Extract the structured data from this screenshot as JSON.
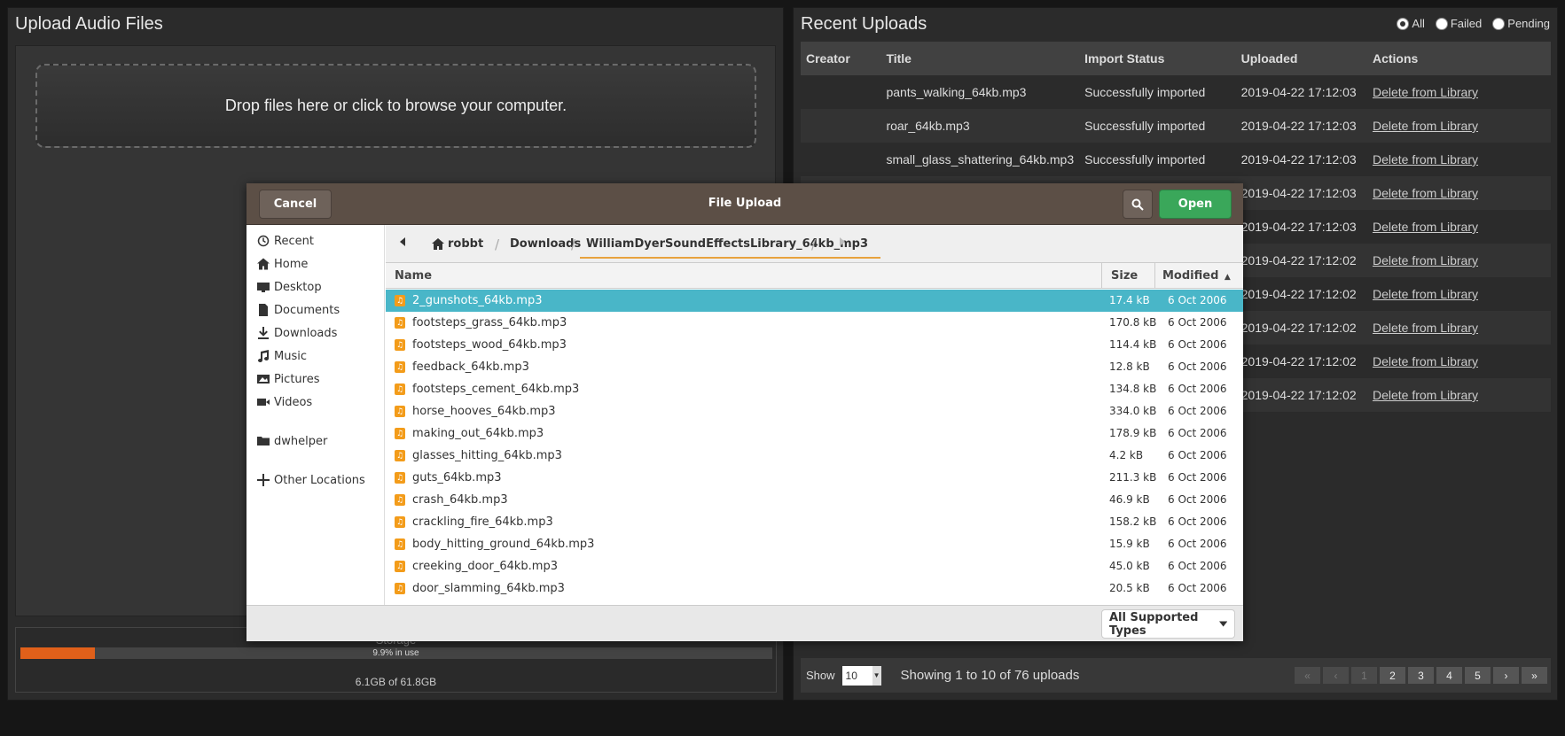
{
  "upload_panel": {
    "title": "Upload Audio Files",
    "dropzone_text": "Drop files here or click to browse your computer.",
    "storage": {
      "label": "Storage",
      "percent_text": "9.9% in use",
      "percent": 9.9,
      "total_text": "6.1GB of 61.8GB"
    }
  },
  "recent": {
    "title": "Recent Uploads",
    "filters": [
      {
        "label": "All",
        "checked": true
      },
      {
        "label": "Failed",
        "checked": false
      },
      {
        "label": "Pending",
        "checked": false
      }
    ],
    "columns": [
      "Creator",
      "Title",
      "Import Status",
      "Uploaded",
      "Actions"
    ],
    "rows": [
      {
        "creator": "",
        "title": "pants_walking_64kb.mp3",
        "status": "Successfully imported",
        "uploaded": "2019-04-22 17:12:03",
        "action": "Delete from Library"
      },
      {
        "creator": "",
        "title": "roar_64kb.mp3",
        "status": "Successfully imported",
        "uploaded": "2019-04-22 17:12:03",
        "action": "Delete from Library"
      },
      {
        "creator": "",
        "title": "small_glass_shattering_64kb.mp3",
        "status": "Successfully imported",
        "uploaded": "2019-04-22 17:12:03",
        "action": "Delete from Library"
      },
      {
        "creator": "",
        "title": "",
        "status": "",
        "uploaded": "2019-04-22 17:12:03",
        "action": "Delete from Library"
      },
      {
        "creator": "",
        "title": "",
        "status": "",
        "uploaded": "2019-04-22 17:12:03",
        "action": "Delete from Library"
      },
      {
        "creator": "",
        "title": "",
        "status": "",
        "uploaded": "2019-04-22 17:12:02",
        "action": "Delete from Library"
      },
      {
        "creator": "",
        "title": "",
        "status": "",
        "uploaded": "2019-04-22 17:12:02",
        "action": "Delete from Library"
      },
      {
        "creator": "",
        "title": "",
        "status": "",
        "uploaded": "2019-04-22 17:12:02",
        "action": "Delete from Library"
      },
      {
        "creator": "",
        "title": "",
        "status": "",
        "uploaded": "2019-04-22 17:12:02",
        "action": "Delete from Library"
      },
      {
        "creator": "",
        "title": "",
        "status": "",
        "uploaded": "2019-04-22 17:12:02",
        "action": "Delete from Library"
      }
    ],
    "footer": {
      "show_label": "Show",
      "show_value": "10",
      "showing_text": "Showing 1 to 10 of 76 uploads",
      "pages": [
        "«",
        "‹",
        "1",
        "2",
        "3",
        "4",
        "5",
        "›",
        "»"
      ]
    }
  },
  "dialog": {
    "title": "File Upload",
    "cancel_label": "Cancel",
    "open_label": "Open",
    "places": [
      "Recent",
      "Home",
      "Desktop",
      "Documents",
      "Downloads",
      "Music",
      "Pictures",
      "Videos",
      "dwhelper",
      "Other Locations"
    ],
    "breadcrumbs": [
      "robbt",
      "Downloads",
      "WilliamDyerSoundEffectsLibrary_64kb_mp3"
    ],
    "columns": {
      "name": "Name",
      "size": "Size",
      "modified": "Modified"
    },
    "files": [
      {
        "name": "2_gunshots_64kb.mp3",
        "size": "17.4 kB",
        "modified": "6 Oct 2006",
        "selected": true
      },
      {
        "name": "footsteps_grass_64kb.mp3",
        "size": "170.8 kB",
        "modified": "6 Oct 2006"
      },
      {
        "name": "footsteps_wood_64kb.mp3",
        "size": "114.4 kB",
        "modified": "6 Oct 2006"
      },
      {
        "name": "feedback_64kb.mp3",
        "size": "12.8 kB",
        "modified": "6 Oct 2006"
      },
      {
        "name": "footsteps_cement_64kb.mp3",
        "size": "134.8 kB",
        "modified": "6 Oct 2006"
      },
      {
        "name": "horse_hooves_64kb.mp3",
        "size": "334.0 kB",
        "modified": "6 Oct 2006"
      },
      {
        "name": "making_out_64kb.mp3",
        "size": "178.9 kB",
        "modified": "6 Oct 2006"
      },
      {
        "name": "glasses_hitting_64kb.mp3",
        "size": "4.2 kB",
        "modified": "6 Oct 2006"
      },
      {
        "name": "guts_64kb.mp3",
        "size": "211.3 kB",
        "modified": "6 Oct 2006"
      },
      {
        "name": "crash_64kb.mp3",
        "size": "46.9 kB",
        "modified": "6 Oct 2006"
      },
      {
        "name": "crackling_fire_64kb.mp3",
        "size": "158.2 kB",
        "modified": "6 Oct 2006"
      },
      {
        "name": "body_hitting_ground_64kb.mp3",
        "size": "15.9 kB",
        "modified": "6 Oct 2006"
      },
      {
        "name": "creeking_door_64kb.mp3",
        "size": "45.0 kB",
        "modified": "6 Oct 2006"
      },
      {
        "name": "door_slamming_64kb.mp3",
        "size": "20.5 kB",
        "modified": "6 Oct 2006"
      }
    ],
    "filter_label": "All Supported Types"
  },
  "colors": {
    "accent_orange": "#e0601a",
    "selection": "#49b6c8",
    "open_green": "#3aa75a",
    "dialog_header": "#5c4f46"
  }
}
